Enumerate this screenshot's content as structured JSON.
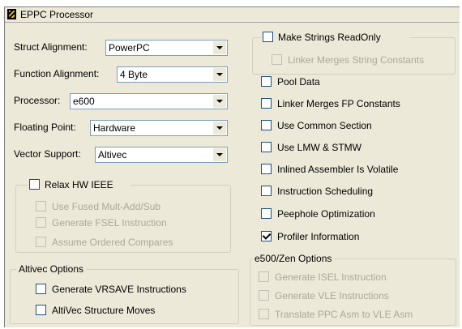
{
  "panel": {
    "title": "EPPC Processor"
  },
  "combos": [
    {
      "label": "Struct Alignment:",
      "value": "PowerPC"
    },
    {
      "label": "Function Alignment:",
      "value": "4 Byte"
    },
    {
      "label": "Processor:",
      "value": "e600"
    },
    {
      "label": "Floating Point:",
      "value": "Hardware"
    },
    {
      "label": "Vector Support:",
      "value": "Altivec"
    }
  ],
  "relax_hw_ieee": {
    "label": "Relax HW IEEE",
    "checked": false,
    "items": [
      {
        "label": "Use Fused Mult-Add/Sub",
        "checked": false,
        "enabled": false
      },
      {
        "label": "Generate FSEL Instruction",
        "checked": false,
        "enabled": false
      },
      {
        "label": "Assume Ordered Compares",
        "checked": false,
        "enabled": false
      }
    ]
  },
  "altivec_options": {
    "title": "Altivec Options",
    "items": [
      {
        "label": "Generate VRSAVE Instructions",
        "checked": false,
        "enabled": true
      },
      {
        "label": "AltiVec Structure Moves",
        "checked": false,
        "enabled": true
      }
    ]
  },
  "make_strings_readonly": {
    "label": "Make Strings ReadOnly",
    "checked": false,
    "items": [
      {
        "label": "Linker Merges String Constants",
        "checked": false,
        "enabled": false
      }
    ]
  },
  "right_options": [
    {
      "label": "Pool Data",
      "checked": false
    },
    {
      "label": "Linker Merges FP Constants",
      "checked": false
    },
    {
      "label": "Use Common Section",
      "checked": false
    },
    {
      "label": "Use LMW & STMW",
      "checked": false
    },
    {
      "label": "Inlined Assembler Is Volatile",
      "checked": false
    },
    {
      "label": "Instruction Scheduling",
      "checked": false
    },
    {
      "label": "Peephole Optimization",
      "checked": false
    },
    {
      "label": "Profiler Information",
      "checked": true
    }
  ],
  "e500_zen_options": {
    "title": "e500/Zen Options",
    "items": [
      {
        "label": "Generate ISEL Instruction",
        "checked": false,
        "enabled": false
      },
      {
        "label": "Generate VLE Instructions",
        "checked": false,
        "enabled": false
      },
      {
        "label": "Translate PPC Asm to VLE Asm",
        "checked": false,
        "enabled": false
      }
    ]
  }
}
